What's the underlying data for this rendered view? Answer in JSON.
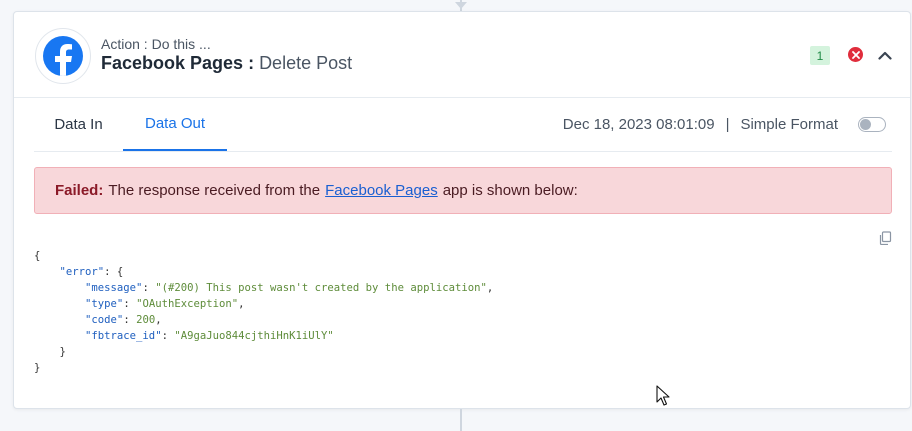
{
  "step": {
    "caption": "Action : Do this ...",
    "app_name": "Facebook Pages",
    "separator": " : ",
    "event_name": "Delete Post",
    "step_number": "1",
    "logo_icon": "facebook-logo",
    "status_icon": "error-icon",
    "collapse_icon": "chevron-up-icon"
  },
  "tabs": [
    {
      "label": "Data In",
      "active": false
    },
    {
      "label": "Data Out",
      "active": true
    }
  ],
  "meta": {
    "timestamp": "Dec 18, 2023 08:01:09",
    "divider": "|",
    "format_label": "Simple Format",
    "simple_format_enabled": false
  },
  "alert": {
    "status": "Failed:",
    "text_before": "The response received from the",
    "link_text": "Facebook Pages",
    "text_after": "app is shown below:"
  },
  "response": {
    "key_error": "\"error\"",
    "key_message": "\"message\"",
    "val_message": "\"(#200) This post wasn't created by the application\"",
    "key_type": "\"type\"",
    "val_type": "\"OAuthException\"",
    "key_code": "\"code\"",
    "val_code": "200",
    "key_fbtrace": "\"fbtrace_id\"",
    "val_fbtrace": "\"A9gaJuo844cjthiHnK1iUlY\""
  },
  "colors": {
    "accent": "#1a73e8",
    "facebook": "#1877f2",
    "error": "#e02d3c",
    "alert_bg": "#f8d7da",
    "badge_bg": "#d4f3dd"
  }
}
